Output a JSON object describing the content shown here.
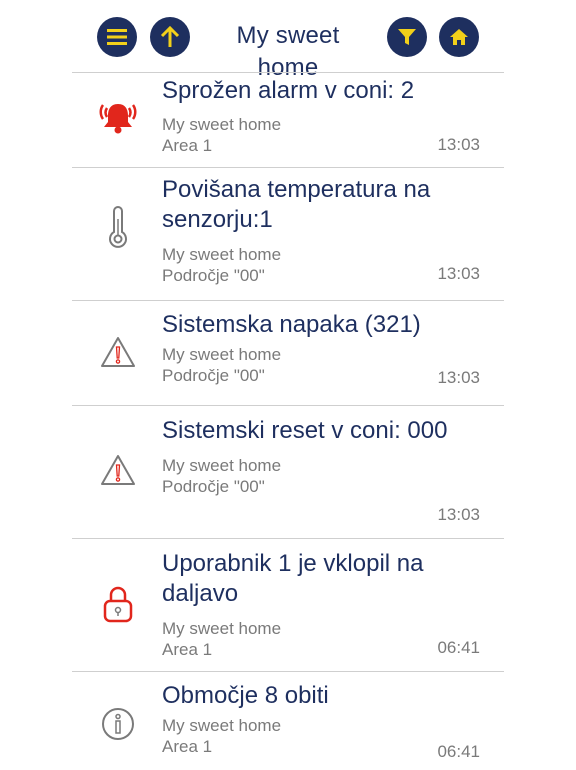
{
  "header": {
    "title": "My sweet home",
    "menu_icon": "menu-icon",
    "up_icon": "arrow-up-icon",
    "filter_icon": "filter-icon",
    "home_icon": "home-icon"
  },
  "colors": {
    "navy": "#1e2f5f",
    "yellow": "#f2d01a",
    "red": "#e1261c",
    "gray": "#7a7a7a"
  },
  "events": [
    {
      "icon": "alarm-bell-icon",
      "message": "Sprožen alarm v coni: 2",
      "site": "My sweet home",
      "area": "Area 1",
      "time": "13:03"
    },
    {
      "icon": "thermometer-icon",
      "message": "Povišana temperatura na senzorju:1",
      "site": "My sweet home",
      "area": "Področje \"00\"",
      "time": "13:03"
    },
    {
      "icon": "warning-icon",
      "message": "Sistemska napaka (321)",
      "site": "My sweet home",
      "area": "Področje \"00\"",
      "time": "13:03"
    },
    {
      "icon": "warning-icon",
      "message": "Sistemski reset v coni: 000",
      "site": "My sweet home",
      "area": "Področje \"00\"",
      "time": "13:03"
    },
    {
      "icon": "lock-icon",
      "message": "Uporabnik 1 je vklopil na daljavo",
      "site": "My sweet home",
      "area": "Area 1",
      "time": "06:41"
    },
    {
      "icon": "info-icon",
      "message": "Območje 8 obiti",
      "site": "My sweet home",
      "area": "Area 1",
      "time": "06:41"
    }
  ]
}
